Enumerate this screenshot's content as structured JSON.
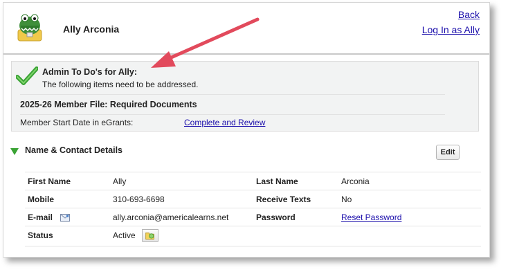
{
  "header": {
    "user_name": "Ally Arconia",
    "back_label": "Back",
    "login_as_label": "Log In as Ally"
  },
  "todo": {
    "title": "Admin To Do's for Ally:",
    "subtitle": "The following items need to be addressed.",
    "section": "2025-26 Member File: Required Documents",
    "item_label": "Member Start Date in eGrants:",
    "item_link": "Complete and Review"
  },
  "contact": {
    "title": "Name & Contact Details",
    "edit_label": "Edit",
    "rows": [
      {
        "l1": "First Name",
        "v1": "Ally",
        "l2": "Last Name",
        "v2": "Arconia"
      },
      {
        "l1": "Mobile",
        "v1": "310-693-6698",
        "l2": "Receive Texts",
        "v2": "No"
      },
      {
        "l1": "E-mail",
        "v1": "ally.arconia@americalearns.net",
        "l2": "Password",
        "v2": "Reset Password"
      },
      {
        "l1": "Status",
        "v1": "Active"
      }
    ]
  },
  "icons": {
    "avatar": "alligator-avatar-icon",
    "check": "checkmark-icon",
    "expand": "triangle-down-icon",
    "email": "email-envelope-icon",
    "status": "status-folder-icon",
    "annotation": "red-arrow-annotation"
  },
  "colors": {
    "link": "#1a0dab",
    "check_green": "#3aa335",
    "arrow_red": "#e24a5c",
    "todo_bg": "#f2f3f3"
  }
}
